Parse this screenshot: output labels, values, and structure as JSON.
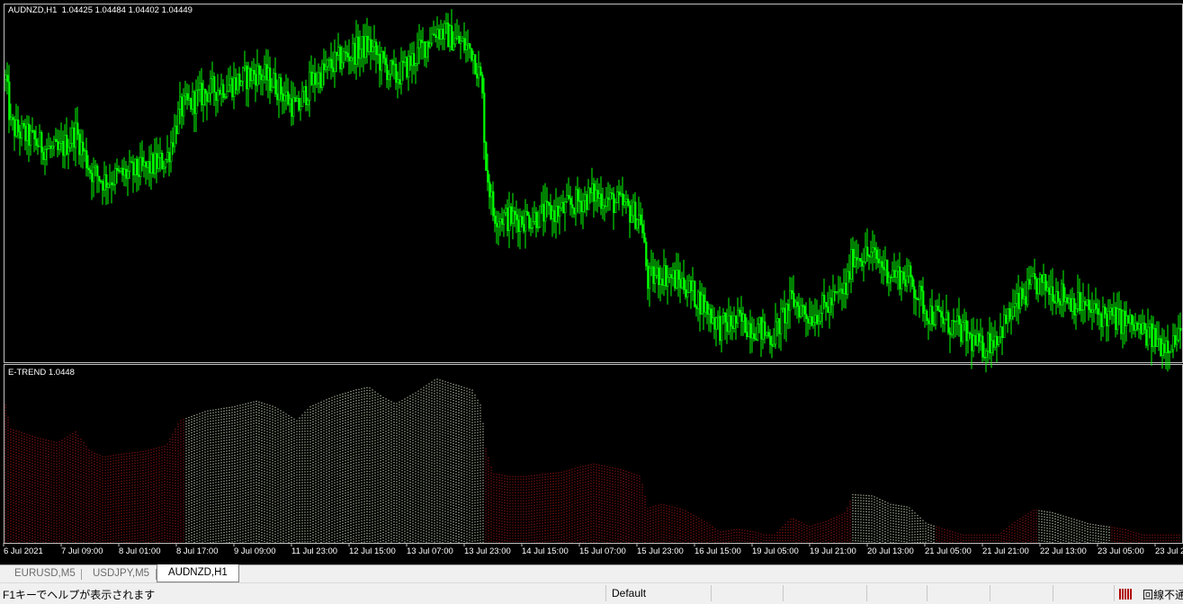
{
  "chart_window": {
    "symbol_label": "AUDNZD,H1  1.04425 1.04484 1.04402 1.04449",
    "indicator_label": "E-TREND 1.0448"
  },
  "chart_data": [
    {
      "type": "candlestick",
      "symbol": "AUDNZD",
      "timeframe": "H1",
      "ohlc_last": {
        "open": 1.04425,
        "high": 1.04484,
        "low": 1.04402,
        "close": 1.04449
      },
      "x_tick_labels": [
        "6 Jul 2021",
        "7 Jul 09:00",
        "8 Jul 01:00",
        "8 Jul 17:00",
        "9 Jul 09:00",
        "11 Jul 23:00",
        "12 Jul 15:00",
        "13 Jul 07:00",
        "13 Jul 23:00",
        "14 Jul 15:00",
        "15 Jul 07:00",
        "15 Jul 23:00",
        "16 Jul 15:00",
        "19 Jul 05:00",
        "19 Jul 21:00",
        "20 Jul 13:00",
        "21 Jul 05:00",
        "21 Jul 21:00",
        "22 Jul 13:00",
        "23 Jul 05:00",
        "23 Jul 2"
      ],
      "close_path": [
        [
          0,
          1.053
        ],
        [
          3,
          1.0538
        ],
        [
          12,
          1.0512
        ],
        [
          40,
          1.0506
        ],
        [
          64,
          1.0502
        ],
        [
          84,
          1.051
        ],
        [
          100,
          1.0496
        ],
        [
          115,
          1.0492
        ],
        [
          135,
          1.0494
        ],
        [
          160,
          1.0496
        ],
        [
          185,
          1.05
        ],
        [
          200,
          1.0518
        ],
        [
          230,
          1.0525
        ],
        [
          260,
          1.0528
        ],
        [
          285,
          1.0532
        ],
        [
          305,
          1.0528
        ],
        [
          330,
          1.0518
        ],
        [
          345,
          1.0528
        ],
        [
          370,
          1.0535
        ],
        [
          395,
          1.054
        ],
        [
          410,
          1.0542
        ],
        [
          425,
          1.0535
        ],
        [
          440,
          1.053
        ],
        [
          462,
          1.0538
        ],
        [
          485,
          1.0548
        ],
        [
          500,
          1.0545
        ],
        [
          525,
          1.054
        ],
        [
          535,
          1.0528
        ],
        [
          540,
          1.0498
        ],
        [
          548,
          1.048
        ],
        [
          565,
          1.0478
        ],
        [
          585,
          1.0478
        ],
        [
          610,
          1.048
        ],
        [
          625,
          1.0481
        ],
        [
          640,
          1.0484
        ],
        [
          660,
          1.0487
        ],
        [
          690,
          1.0483
        ],
        [
          712,
          1.0478
        ],
        [
          720,
          1.0455
        ],
        [
          735,
          1.0458
        ],
        [
          760,
          1.0454
        ],
        [
          785,
          1.0445
        ],
        [
          800,
          1.0438
        ],
        [
          820,
          1.044
        ],
        [
          840,
          1.0438
        ],
        [
          858,
          1.0434
        ],
        [
          880,
          1.0448
        ],
        [
          900,
          1.0442
        ],
        [
          920,
          1.0446
        ],
        [
          940,
          1.0452
        ],
        [
          948,
          1.0465
        ],
        [
          970,
          1.0464
        ],
        [
          990,
          1.0458
        ],
        [
          1010,
          1.0456
        ],
        [
          1020,
          1.045
        ],
        [
          1030,
          1.0444
        ],
        [
          1050,
          1.044
        ],
        [
          1070,
          1.0436
        ],
        [
          1090,
          1.043
        ],
        [
          1110,
          1.0436
        ],
        [
          1130,
          1.0446
        ],
        [
          1150,
          1.0454
        ],
        [
          1170,
          1.0452
        ],
        [
          1190,
          1.0448
        ],
        [
          1210,
          1.0444
        ],
        [
          1230,
          1.0442
        ],
        [
          1250,
          1.044
        ],
        [
          1270,
          1.0436
        ],
        [
          1290,
          1.0432
        ],
        [
          1315,
          1.0434
        ]
      ],
      "y_range": [
        1.0426,
        1.0556
      ],
      "colors": {
        "bull": "#00ff00",
        "bear": "#00ff00",
        "background": "#000000"
      }
    },
    {
      "type": "bar",
      "name": "E-TREND",
      "value_last": 1.0448,
      "segments": [
        {
          "trend": "down",
          "from": 0,
          "to": 207
        },
        {
          "trend": "up",
          "from": 207,
          "to": 540
        },
        {
          "trend": "down",
          "from": 540,
          "to": 948
        },
        {
          "trend": "up",
          "from": 948,
          "to": 1040
        },
        {
          "trend": "down",
          "from": 1040,
          "to": 1155
        },
        {
          "trend": "up",
          "from": 1155,
          "to": 1235
        },
        {
          "trend": "down",
          "from": 1235,
          "to": 1315
        }
      ],
      "colors": {
        "up": "#e8f5d0",
        "down": "#b01818"
      }
    }
  ],
  "tabs": [
    {
      "label": "EURUSD,M5",
      "active": false
    },
    {
      "label": "USDJPY,M5",
      "active": false
    },
    {
      "label": "AUDNZD,H1",
      "active": true
    }
  ],
  "status_bar": {
    "help_text": "F1キーでヘルプが表示されます",
    "profile": "Default",
    "connection": "回線不通"
  }
}
